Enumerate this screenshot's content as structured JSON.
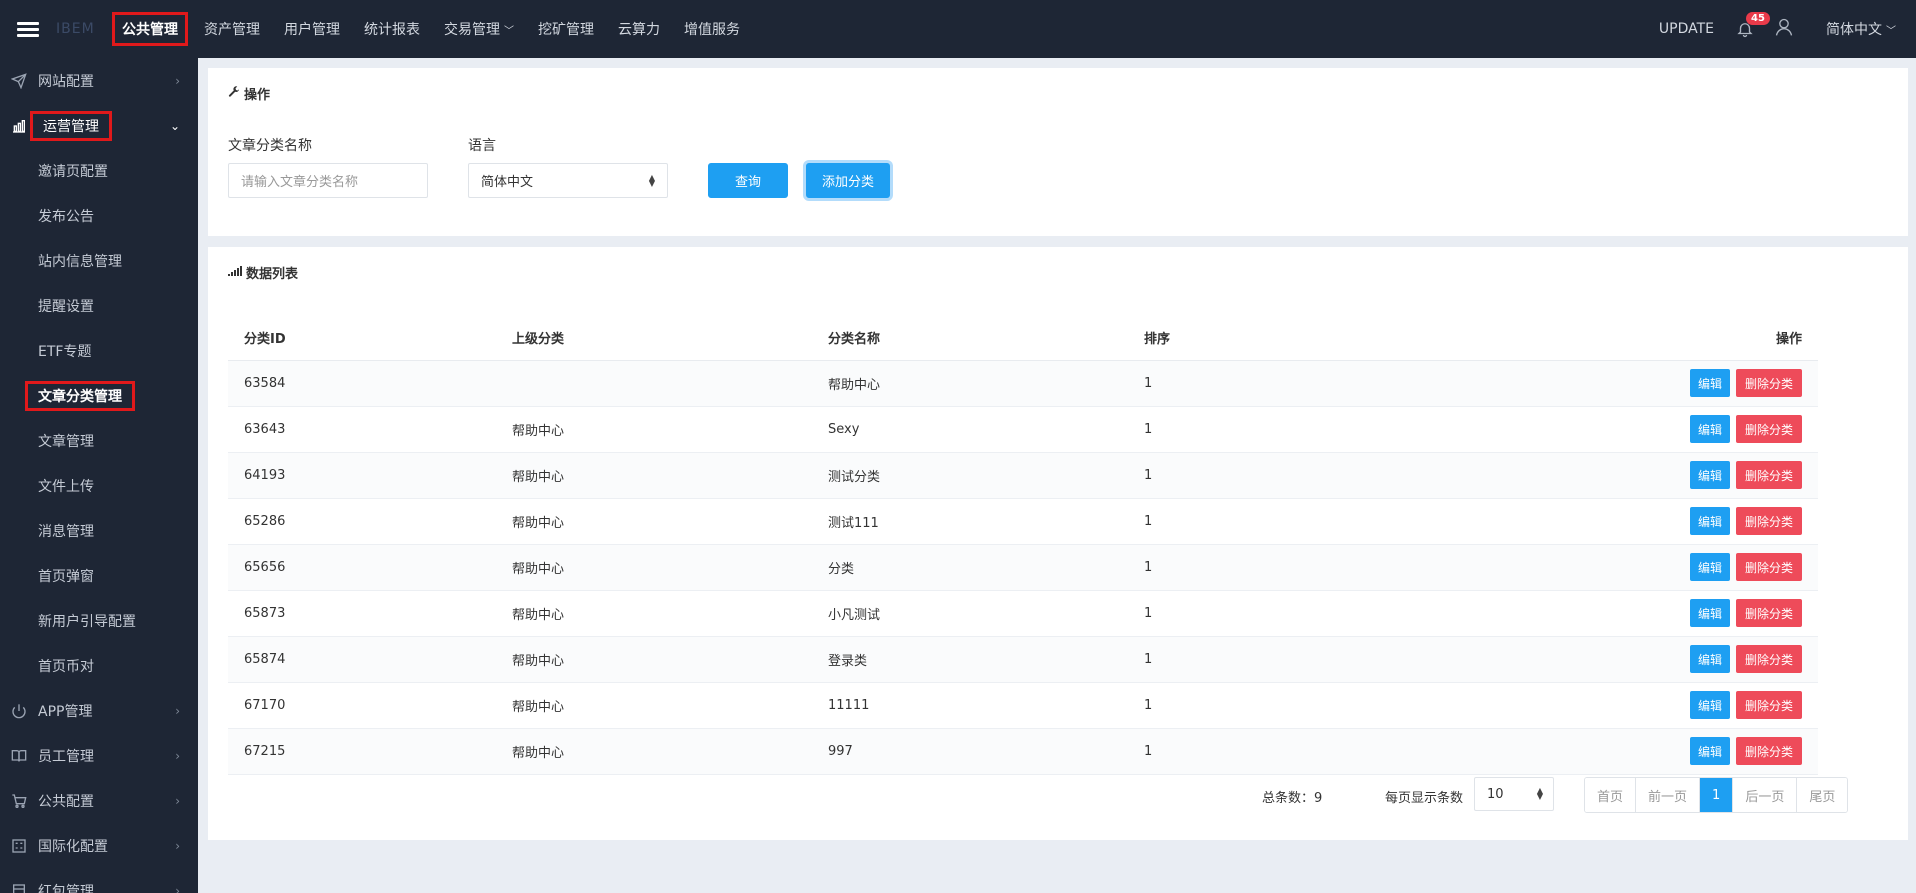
{
  "header": {
    "logo": "IBEM",
    "nav": [
      {
        "label": "公共管理"
      },
      {
        "label": "资产管理"
      },
      {
        "label": "用户管理"
      },
      {
        "label": "统计报表"
      },
      {
        "label": "交易管理"
      },
      {
        "label": "挖矿管理"
      },
      {
        "label": "云算力"
      },
      {
        "label": "增值服务"
      }
    ],
    "update": "UPDATE",
    "notifications": "45",
    "language": "简体中文"
  },
  "sidebar": {
    "website_config": "网站配置",
    "operations": "运营管理",
    "sub": [
      "邀请页配置",
      "发布公告",
      "站内信息管理",
      "提醒设置",
      "ETF专题",
      "文章分类管理",
      "文章管理",
      "文件上传",
      "消息管理",
      "首页弹窗",
      "新用户引导配置",
      "首页币对"
    ],
    "app_mgmt": "APP管理",
    "staff_mgmt": "员工管理",
    "public_config": "公共配置",
    "i18n_config": "国际化配置",
    "redpacket_mgmt": "红包管理"
  },
  "ops_panel": {
    "title": "操作",
    "name_label": "文章分类名称",
    "name_placeholder": "请输入文章分类名称",
    "lang_label": "语言",
    "lang_value": "简体中文",
    "query_btn": "查询",
    "add_btn": "添加分类"
  },
  "list_panel": {
    "title": "数据列表",
    "columns": [
      "分类ID",
      "上级分类",
      "分类名称",
      "排序",
      "操作"
    ],
    "rows": [
      {
        "id": "63584",
        "parent": "",
        "name": "帮助中心",
        "sort": "1"
      },
      {
        "id": "63643",
        "parent": "帮助中心",
        "name": "Sexy",
        "sort": "1"
      },
      {
        "id": "64193",
        "parent": "帮助中心",
        "name": "测试分类",
        "sort": "1"
      },
      {
        "id": "65286",
        "parent": "帮助中心",
        "name": "测试111",
        "sort": "1"
      },
      {
        "id": "65656",
        "parent": "帮助中心",
        "name": "分类",
        "sort": "1"
      },
      {
        "id": "65873",
        "parent": "帮助中心",
        "name": "小凡测试",
        "sort": "1"
      },
      {
        "id": "65874",
        "parent": "帮助中心",
        "name": "登录类",
        "sort": "1"
      },
      {
        "id": "67170",
        "parent": "帮助中心",
        "name": "11111",
        "sort": "1"
      },
      {
        "id": "67215",
        "parent": "帮助中心",
        "name": "997",
        "sort": "1"
      }
    ],
    "edit_btn": "编辑",
    "delete_btn": "删除分类"
  },
  "pager": {
    "total": "总条数：9",
    "per_page_label": "每页显示条数",
    "per_page_value": "10",
    "first": "首页",
    "prev": "前一页",
    "current": "1",
    "next": "后一页",
    "last": "尾页"
  },
  "colors": {
    "topbar": "#1e2635",
    "primary": "#1e9ff2",
    "danger": "#ee4b5a",
    "highlight": "#e0191b"
  }
}
